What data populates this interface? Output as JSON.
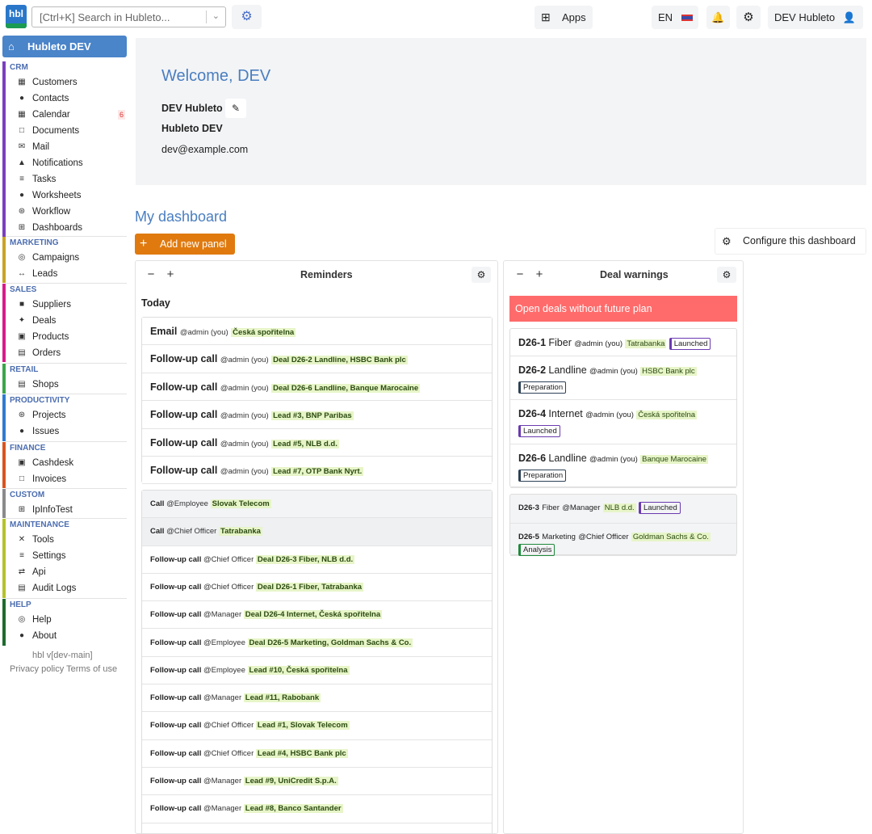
{
  "topbar": {
    "logo": "hbl",
    "search_placeholder": "[Ctrl+K] Search in Hubleto...",
    "apps_label": "Apps",
    "lang": "EN",
    "user": "DEV Hubleto",
    "icons": {
      "bot": "robot-icon",
      "apps": "grid-icon",
      "bell": "bell-icon",
      "gear": "gear-icon",
      "user": "user-icon"
    }
  },
  "sidebar": {
    "home": "Hubleto DEV",
    "groups": [
      {
        "title": "CRM",
        "color": "#7b3fbe",
        "items": [
          {
            "label": "Customers",
            "icon": "id-card-icon"
          },
          {
            "label": "Contacts",
            "icon": "person-icon"
          },
          {
            "label": "Calendar",
            "icon": "calendar-icon",
            "badge": "6"
          },
          {
            "label": "Documents",
            "icon": "document-icon"
          },
          {
            "label": "Mail",
            "icon": "envelope-icon"
          },
          {
            "label": "Notifications",
            "icon": "bell-icon"
          },
          {
            "label": "Tasks",
            "icon": "checklist-icon"
          },
          {
            "label": "Worksheets",
            "icon": "user-clock-icon"
          },
          {
            "label": "Workflow",
            "icon": "workflow-icon"
          },
          {
            "label": "Dashboards",
            "icon": "table-icon"
          }
        ]
      },
      {
        "title": "MARKETING",
        "color": "#c9a227",
        "items": [
          {
            "label": "Campaigns",
            "icon": "bullseye-icon"
          },
          {
            "label": "Leads",
            "icon": "people-arrows-icon"
          }
        ]
      },
      {
        "title": "SALES",
        "color": "#d81b8a",
        "items": [
          {
            "label": "Suppliers",
            "icon": "truck-icon"
          },
          {
            "label": "Deals",
            "icon": "handshake-icon"
          },
          {
            "label": "Products",
            "icon": "box-icon"
          },
          {
            "label": "Orders",
            "icon": "receipt-icon"
          }
        ]
      },
      {
        "title": "RETAIL",
        "color": "#3aa54a",
        "items": [
          {
            "label": "Shops",
            "icon": "shop-icon"
          }
        ]
      },
      {
        "title": "PRODUCTIVITY",
        "color": "#2f7bd0",
        "items": [
          {
            "label": "Projects",
            "icon": "diagram-icon"
          },
          {
            "label": "Issues",
            "icon": "chat-icon"
          }
        ]
      },
      {
        "title": "FINANCE",
        "color": "#d9541e",
        "items": [
          {
            "label": "Cashdesk",
            "icon": "cash-register-icon"
          },
          {
            "label": "Invoices",
            "icon": "invoice-icon"
          }
        ]
      },
      {
        "title": "CUSTOM",
        "color": "#8a8a8a",
        "items": [
          {
            "label": "IpInfoTest",
            "icon": "network-icon"
          }
        ]
      },
      {
        "title": "MAINTENANCE",
        "color": "#b5c22a",
        "items": [
          {
            "label": "Tools",
            "icon": "tools-icon"
          },
          {
            "label": "Settings",
            "icon": "sliders-icon"
          },
          {
            "label": "Api",
            "icon": "arrows-icon"
          },
          {
            "label": "Audit Logs",
            "icon": "log-icon"
          }
        ]
      },
      {
        "title": "HELP",
        "color": "#1e6b2e",
        "items": [
          {
            "label": "Help",
            "icon": "lifebuoy-icon"
          },
          {
            "label": "About",
            "icon": "question-icon"
          }
        ]
      }
    ],
    "version": "hbl v[dev-main]",
    "privacy": "Privacy policy",
    "terms": "Terms of use"
  },
  "welcome": {
    "title": "Welcome, DEV",
    "name": "DEV Hubleto",
    "company": "Hubleto DEV",
    "email": "dev@example.com"
  },
  "dashboard": {
    "title": "My dashboard",
    "add_panel": "Add new panel",
    "configure": "Configure this dashboard"
  },
  "reminders": {
    "title": "Reminders",
    "today_label": "Today",
    "today": [
      {
        "type": "Email",
        "who": "@admin (you)",
        "ref": "Česká spořitelna"
      },
      {
        "type": "Follow-up call",
        "who": "@admin (you)",
        "ref": "Deal D26-2 Landline, HSBC Bank plc"
      },
      {
        "type": "Follow-up call",
        "who": "@admin (you)",
        "ref": "Deal D26-6 Landline, Banque Marocaine"
      },
      {
        "type": "Follow-up call",
        "who": "@admin (you)",
        "ref": "Lead #3, BNP Paribas"
      },
      {
        "type": "Follow-up call",
        "who": "@admin (you)",
        "ref": "Lead #5, NLB d.d."
      },
      {
        "type": "Follow-up call",
        "who": "@admin (you)",
        "ref": "Lead #7, OTP Bank Nyrt."
      }
    ],
    "others": [
      {
        "type": "Call",
        "who": "@Employee",
        "ref": "Slovak Telecom"
      },
      {
        "type": "Call",
        "who": "@Chief Officer",
        "ref": "Tatrabanka"
      },
      {
        "type": "Follow-up call",
        "who": "@Chief Officer",
        "ref": "Deal D26-3 Fiber, NLB d.d."
      },
      {
        "type": "Follow-up call",
        "who": "@Chief Officer",
        "ref": "Deal D26-1 Fiber, Tatrabanka"
      },
      {
        "type": "Follow-up call",
        "who": "@Manager",
        "ref": "Deal D26-4 Internet, Česká spořitelna"
      },
      {
        "type": "Follow-up call",
        "who": "@Employee",
        "ref": "Deal D26-5 Marketing, Goldman Sachs & Co."
      },
      {
        "type": "Follow-up call",
        "who": "@Employee",
        "ref": "Lead #10, Česká spořitelna"
      },
      {
        "type": "Follow-up call",
        "who": "@Manager",
        "ref": "Lead #11, Rabobank"
      },
      {
        "type": "Follow-up call",
        "who": "@Chief Officer",
        "ref": "Lead #1, Slovak Telecom"
      },
      {
        "type": "Follow-up call",
        "who": "@Chief Officer",
        "ref": "Lead #4, HSBC Bank plc"
      },
      {
        "type": "Follow-up call",
        "who": "@Manager",
        "ref": "Lead #9, UniCredit S.p.A."
      },
      {
        "type": "Follow-up call",
        "who": "@Manager",
        "ref": "Lead #8, Banco Santander"
      }
    ]
  },
  "deal_warnings": {
    "title": "Deal warnings",
    "banner": "Open deals without future plan",
    "mine": [
      {
        "code": "D26-1",
        "title": "Fiber",
        "who": "@admin (you)",
        "company": "Tatrabanka",
        "status": "Launched",
        "status_class": "st-launched"
      },
      {
        "code": "D26-2",
        "title": "Landline",
        "who": "@admin (you)",
        "company": "HSBC Bank plc",
        "status": "Preparation",
        "status_class": "st-prep"
      },
      {
        "code": "D26-4",
        "title": "Internet",
        "who": "@admin (you)",
        "company": "Česká spořitelna",
        "status": "Launched",
        "status_class": "st-launched"
      },
      {
        "code": "D26-6",
        "title": "Landline",
        "who": "@admin (you)",
        "company": "Banque Marocaine",
        "status": "Preparation",
        "status_class": "st-prep"
      }
    ],
    "others": [
      {
        "code": "D26-3",
        "title": "Fiber",
        "who": "@Manager",
        "company": "NLB d.d.",
        "status": "Launched",
        "status_class": "st-launched"
      },
      {
        "code": "D26-5",
        "title": "Marketing",
        "who": "@Chief Officer",
        "company": "Goldman Sachs & Co.",
        "status": "Analysis",
        "status_class": "st-analysis"
      }
    ]
  }
}
